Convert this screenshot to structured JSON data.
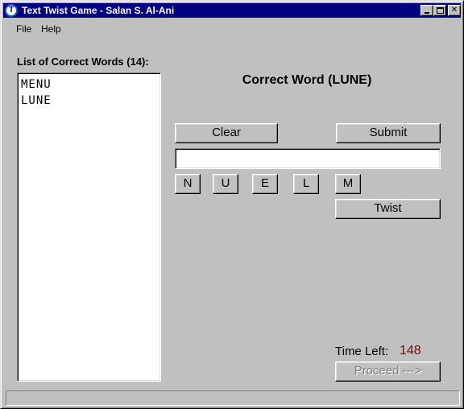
{
  "window": {
    "title": "Text Twist Game - Salan S. Al-Ani",
    "icon_letter": "T"
  },
  "menu": {
    "items": [
      "File",
      "Help"
    ]
  },
  "word_list": {
    "label": "List of Correct Words (14):",
    "items": [
      "MENU",
      "LUNE"
    ]
  },
  "status": {
    "message": "Correct Word (LUNE)"
  },
  "controls": {
    "clear_label": "Clear",
    "submit_label": "Submit",
    "twist_label": "Twist",
    "proceed_label": "Proceed --->",
    "input_value": ""
  },
  "letters": [
    "N",
    "U",
    "E",
    "L",
    "M"
  ],
  "timer": {
    "label": "Time Left:",
    "value": "148",
    "value_color": "#8b0000"
  },
  "titlebar_buttons": {
    "close_glyph": "✕"
  }
}
